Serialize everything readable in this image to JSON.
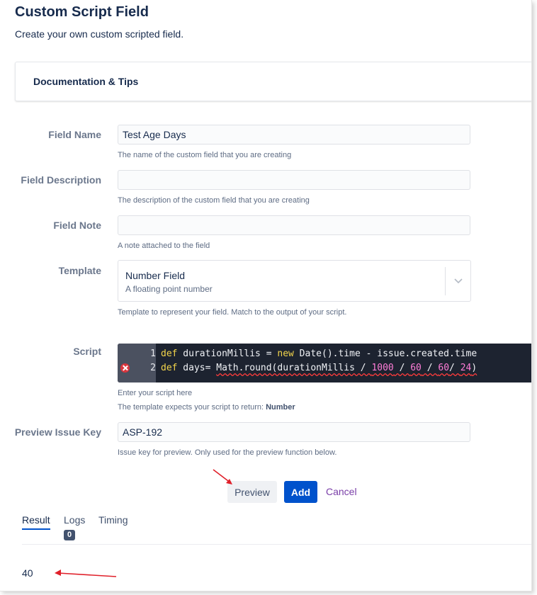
{
  "page": {
    "title": "Custom Script Field",
    "subtitle": "Create your own custom scripted field."
  },
  "documentation": {
    "label": "Documentation & Tips"
  },
  "form": {
    "field_name": {
      "label": "Field Name",
      "value": "Test Age Days",
      "help": "The name of the custom field that you are creating"
    },
    "field_description": {
      "label": "Field Description",
      "value": "",
      "help": "The description of the custom field that you are creating"
    },
    "field_note": {
      "label": "Field Note",
      "value": "",
      "help": "A note attached to the field"
    },
    "template": {
      "label": "Template",
      "selected": "Number Field",
      "selected_description": "A floating point number",
      "help": "Template to represent your field. Match to the output of your script."
    },
    "script": {
      "label": "Script",
      "line_numbers": [
        "1",
        "2"
      ],
      "line1": {
        "kw1": "def",
        "t1": " durationMillis = ",
        "kw2": "new",
        "t2": " Date().time - issue.created.time"
      },
      "line2": {
        "kw1": "def",
        "t1": " days= ",
        "t2": "Math.round(durationMillis / ",
        "n1": "1000",
        "s1": " / ",
        "n2": "60",
        "s2": " / ",
        "n3": "60",
        "s3": "/ ",
        "n4": "24",
        "end": ")"
      },
      "help": "Enter your script here",
      "return_help_prefix": "The template expects your script to return: ",
      "return_type": "Number"
    },
    "preview_issue_key": {
      "label": "Preview Issue Key",
      "value": "ASP-192",
      "help": "Issue key for preview. Only used for the preview function below."
    }
  },
  "actions": {
    "preview_label": "Preview",
    "add_label": "Add",
    "cancel_label": "Cancel"
  },
  "tabs": {
    "result": "Result",
    "logs": "Logs",
    "logs_count": "0",
    "timing": "Timing"
  },
  "result": {
    "value": "40"
  },
  "colors": {
    "primary": "#0052cc",
    "editor_bg": "#1d2330",
    "keyword": "#f3d54b",
    "number": "#ff7dd8",
    "error": "#d9363e",
    "annotation_arrow": "#e0202a",
    "cancel_link": "#7a3ea8"
  }
}
